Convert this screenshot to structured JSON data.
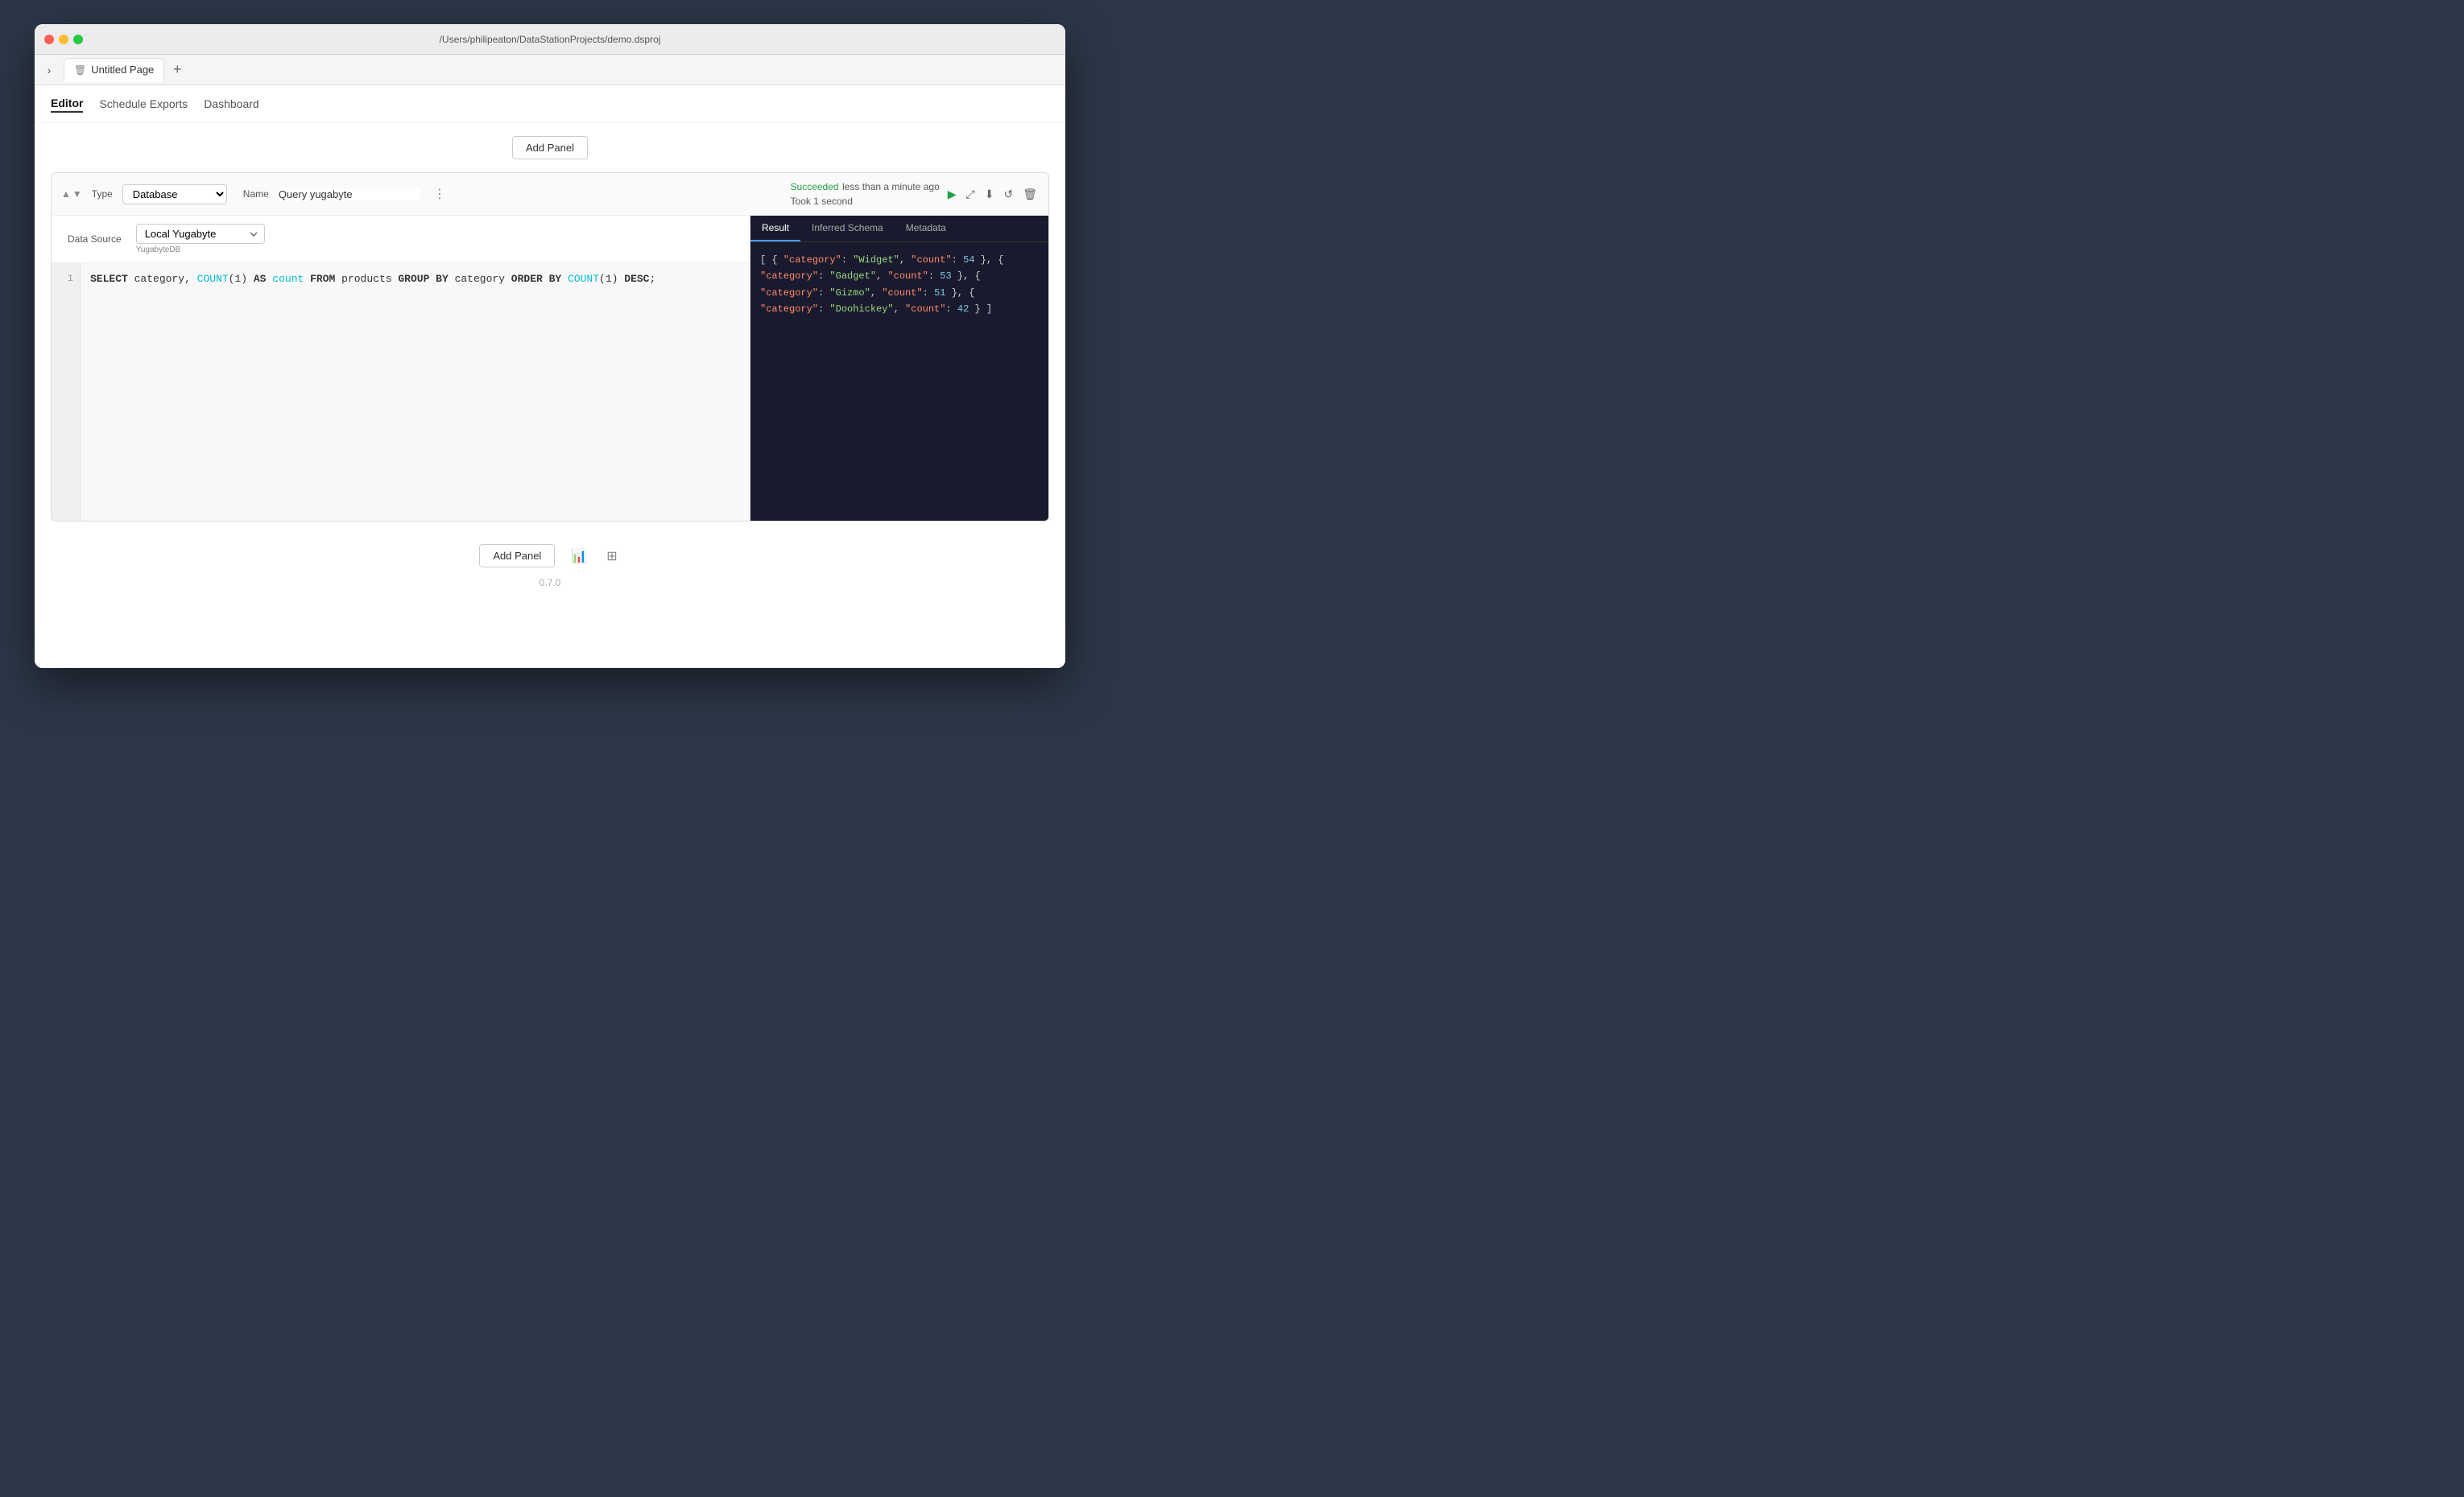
{
  "window": {
    "title": "/Users/philipeaton/DataStationProjects/demo.dsproj"
  },
  "tab": {
    "icon": "🗑",
    "name": "Untitled Page",
    "add_label": "+"
  },
  "navbar": {
    "items": [
      {
        "label": "Editor",
        "active": true
      },
      {
        "label": "Schedule Exports",
        "active": false
      },
      {
        "label": "Dashboard",
        "active": false
      }
    ]
  },
  "add_panel": {
    "label": "Add Panel"
  },
  "panel": {
    "type_label": "Type",
    "type_value": "Database",
    "name_label": "Name",
    "name_value": "Query yugabyte",
    "status_success": "Succeeded",
    "status_time": "less than a minute ago",
    "status_took": "Took 1 second",
    "dots": "⋮",
    "datasource_label": "Data Source",
    "datasource_value": "Local Yugabyte",
    "datasource_sub": "YugabyteDB"
  },
  "editor": {
    "line_number": "1",
    "code": "SELECT category, COUNT(1) AS count FROM products GROUP BY category ORDER BY COUNT(1) DESC;"
  },
  "result": {
    "tabs": [
      {
        "label": "Result",
        "active": true
      },
      {
        "label": "Inferred Schema",
        "active": false
      },
      {
        "label": "Metadata",
        "active": false
      }
    ],
    "json_lines": [
      "  { \"category\": \"Widget\", \"count\": 54 },",
      "  { \"category\": \"Gadget\", \"count\": 53 },",
      "  { \"category\": \"Gizmo\",  \"count\": 51 },",
      "  { \"category\": \"Doohickey\", \"count\": 42 }"
    ]
  },
  "bottom": {
    "add_panel_label": "Add Panel",
    "version": "0.7.0"
  },
  "icons": {
    "sidebar_toggle": "›",
    "run": "▶",
    "expand": "⤢",
    "download": "⬇",
    "refresh": "↺",
    "delete": "🗑",
    "bar_chart": "📊",
    "grid": "⊞"
  }
}
